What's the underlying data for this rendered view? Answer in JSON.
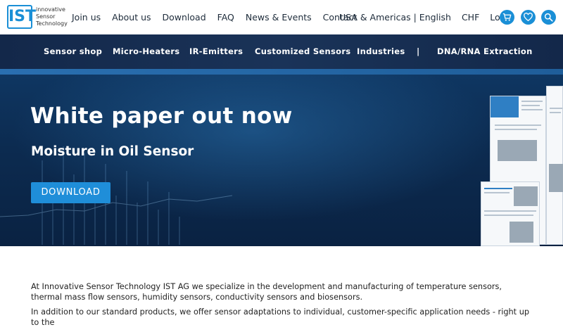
{
  "logo": {
    "mark": "IST",
    "lines": [
      "innovative",
      "Sensor",
      "Technology"
    ]
  },
  "topnav": {
    "items": [
      "Join us",
      "About us",
      "Download",
      "FAQ",
      "News & Events",
      "Contact"
    ]
  },
  "topright": {
    "region": "USA & Americas | English",
    "currency": "CHF",
    "login": "Login"
  },
  "icons": {
    "cart": "cart-icon",
    "wishlist": "heart-icon",
    "search": "search-icon",
    "accent": "#1a8fd6"
  },
  "mainnav": {
    "items": [
      "Sensor shop",
      "Micro-Heaters",
      "IR-Emitters",
      "Customized Sensors",
      "Industries",
      "|",
      "DNA/RNA Extraction"
    ]
  },
  "hero": {
    "title": "White paper out now",
    "subtitle": "Moisture in Oil Sensor",
    "button": "DOWNLOAD"
  },
  "content": {
    "p1": "At Innovative Sensor Technology IST AG we specialize in the  development and manufacturing of temperature sensors, thermal mass flow sensors, humidity sensors, conductivity sensors and biosensors.",
    "p2": "In addition to our standard products, we offer sensor adaptations to individual, customer-specific application needs - right up to the"
  }
}
